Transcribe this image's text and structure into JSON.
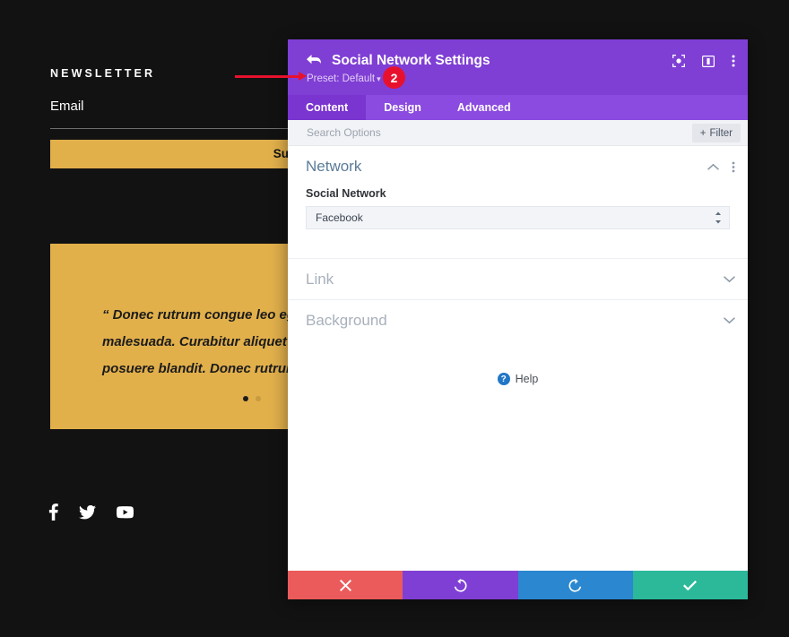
{
  "background_page": {
    "newsletter_heading": "NEWSLETTER",
    "email_label": "Email",
    "subscribe_label": "Subscribe",
    "testimonial_quote": "“ Donec rutrum congue leo eget malesuada. Curabitur aliquet quam id dui posuere blandit. Donec rutrum",
    "carousel": {
      "dots": 2,
      "active_index": 0
    },
    "social_icons": [
      "facebook-icon",
      "twitter-icon",
      "youtube-icon"
    ],
    "colors": {
      "page_bg": "#121212",
      "accent_gold": "#e2b04b",
      "text_light": "#ffffff"
    }
  },
  "annotation": {
    "step_number": "2",
    "arrow": "right-arrow",
    "color": "#e8112d"
  },
  "modal": {
    "header": {
      "back_icon": "back-arrow-icon",
      "title": "Social Network Settings",
      "preset_label": "Preset: Default",
      "preset_caret": "▾",
      "icons": [
        "fullscreen-icon",
        "layout-split-icon",
        "more-vertical-icon"
      ]
    },
    "tabs": [
      {
        "label": "Content",
        "active": true
      },
      {
        "label": "Design",
        "active": false
      },
      {
        "label": "Advanced",
        "active": false
      }
    ],
    "search": {
      "placeholder": "Search Options",
      "filter_label": "Filter",
      "filter_icon": "plus-icon"
    },
    "sections": [
      {
        "title": "Network",
        "expanded": true,
        "collapse_icon": "chevron-up-icon",
        "menu_icon": "more-vertical-icon",
        "field_label": "Social Network",
        "field_value": "Facebook",
        "field_stepper_icon": "stepper-updown-icon"
      },
      {
        "title": "Link",
        "expanded": false,
        "collapse_icon": "chevron-down-icon"
      },
      {
        "title": "Background",
        "expanded": false,
        "collapse_icon": "chevron-down-icon"
      }
    ],
    "help": {
      "icon": "question-circle-icon",
      "label": "Help"
    },
    "footer_buttons": [
      {
        "name": "cancel",
        "icon": "close-icon",
        "color": "#eb5b5b"
      },
      {
        "name": "undo",
        "icon": "undo-icon",
        "color": "#7f3fd4"
      },
      {
        "name": "redo",
        "icon": "redo-icon",
        "color": "#2a87d0"
      },
      {
        "name": "save",
        "icon": "check-icon",
        "color": "#2bb99a"
      }
    ],
    "colors": {
      "header_purple": "#7f3fd4",
      "tabbar_purple": "#8b4ae0",
      "active_tab_purple": "#7a34cf",
      "section_title_blue": "#5b7c99"
    }
  }
}
